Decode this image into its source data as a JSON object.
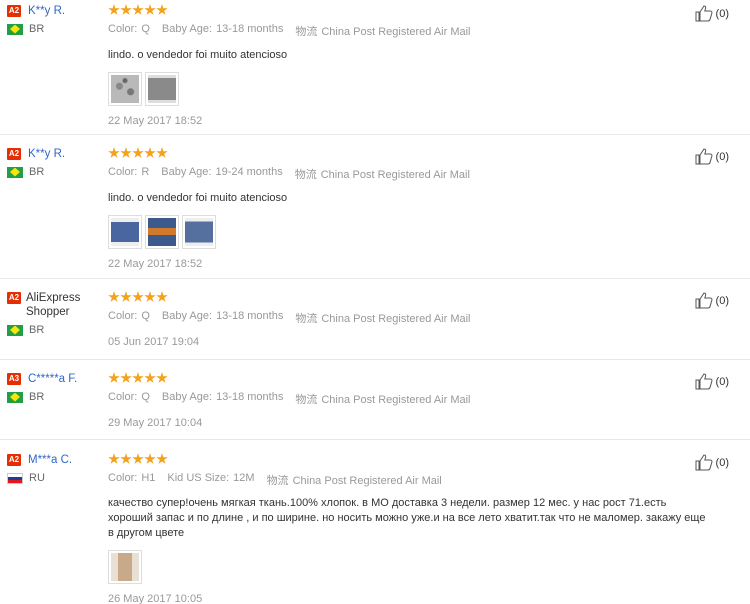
{
  "reviews": [
    {
      "badge": "A2",
      "user": "K**y R.",
      "country": "BR",
      "flag": "br",
      "meta": [
        {
          "key": "Color:",
          "value": "Q"
        },
        {
          "key": "Baby Age:",
          "value": "13-18 months"
        },
        {
          "key": "物流",
          "value": "China Post Registered Air Mail"
        }
      ],
      "text": "lindo. o vendedor foi muito atencioso",
      "thumbs": 2,
      "date": "22 May 2017 18:52",
      "likes": "(0)"
    },
    {
      "badge": "A2",
      "user": "K**y R.",
      "country": "BR",
      "flag": "br",
      "meta": [
        {
          "key": "Color:",
          "value": "R"
        },
        {
          "key": "Baby Age:",
          "value": "19-24 months"
        },
        {
          "key": "物流",
          "value": "China Post Registered Air Mail"
        }
      ],
      "text": "lindo. o vendedor foi muito atencioso",
      "thumbs": 3,
      "date": "22 May 2017 18:52",
      "likes": "(0)"
    },
    {
      "badge": "A2",
      "user": "AliExpress Shopper",
      "country": "BR",
      "flag": "br",
      "meta": [
        {
          "key": "Color:",
          "value": "Q"
        },
        {
          "key": "Baby Age:",
          "value": "13-18 months"
        },
        {
          "key": "物流",
          "value": "China Post Registered Air Mail"
        }
      ],
      "text": "",
      "thumbs": 0,
      "date": "05 Jun 2017 19:04",
      "likes": "(0)"
    },
    {
      "badge": "A3",
      "user": "C*****a F.",
      "country": "BR",
      "flag": "br",
      "meta": [
        {
          "key": "Color:",
          "value": "Q"
        },
        {
          "key": "Baby Age:",
          "value": "13-18 months"
        },
        {
          "key": "物流",
          "value": "China Post Registered Air Mail"
        }
      ],
      "text": "",
      "thumbs": 0,
      "date": "29 May 2017 10:04",
      "likes": "(0)"
    },
    {
      "badge": "A2",
      "user": "M***a C.",
      "country": "RU",
      "flag": "ru",
      "meta": [
        {
          "key": "Color:",
          "value": "H1"
        },
        {
          "key": "Kid US Size:",
          "value": "12M"
        },
        {
          "key": "物流",
          "value": "China Post Registered Air Mail"
        }
      ],
      "text": "качество супер!очень мягкая ткань.100% хлопок. в МО доставка 3 недели. размер 12 мес. у нас рост 71.есть хороший запас и по длине , и по ширине. но носить можно уже.и на все лето хватит.так что не маломер. закажу еще в другом цвете",
      "thumbs": 1,
      "date": "26 May 2017 10:05",
      "likes": "(0)"
    }
  ],
  "colors": {
    "star": "#f4a21d",
    "badge": "#e62e04",
    "username": "#2f67c8"
  }
}
